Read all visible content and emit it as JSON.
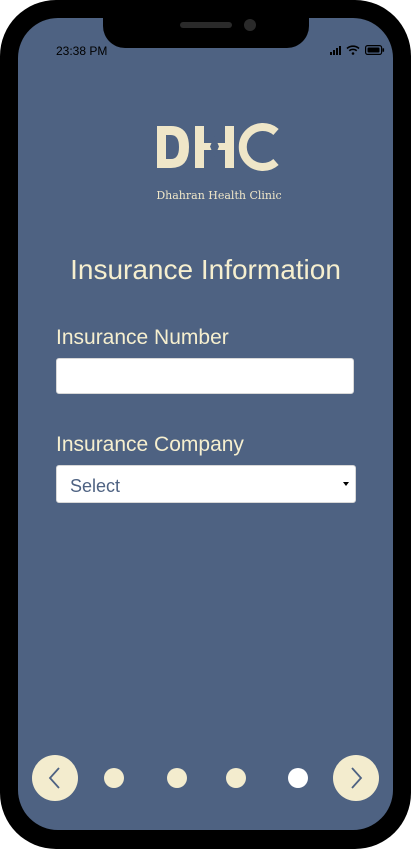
{
  "status_bar": {
    "time": "23:38 PM"
  },
  "logo": {
    "text": "Dhahran Health Clinic",
    "icon": "dhc-logo"
  },
  "page": {
    "title": "Insurance Information"
  },
  "form": {
    "insurance_number": {
      "label": "Insurance Number",
      "value": "",
      "placeholder": ""
    },
    "insurance_company": {
      "label": "Insurance Company",
      "selected": "Select"
    }
  },
  "pager": {
    "prev_icon": "chevron-left-icon",
    "next_icon": "chevron-right-icon",
    "total_steps": 4,
    "current_step": 4
  },
  "colors": {
    "background": "#4e6282",
    "accent": "#f3ecce",
    "active_dot": "#ffffff",
    "inactive_dot": "#f3ecce"
  }
}
